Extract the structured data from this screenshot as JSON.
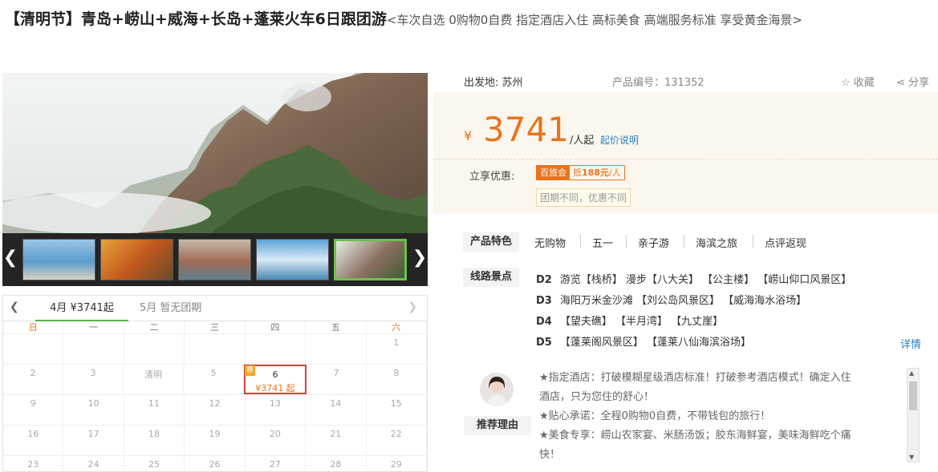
{
  "title": {
    "main": "【清明节】青岛+崂山+威海+长岛+蓬莱火车6日跟团游",
    "sub": "<车次自选 0购物0自费 指定酒店入住 高标美食 高端服务标准 享受黄金海景>"
  },
  "gallery": {
    "prev": "❮",
    "next": "❯",
    "active_index": 4
  },
  "calendar": {
    "prev": "❮",
    "next": "❯",
    "months": [
      {
        "label": "4月 ¥3741起",
        "active": true
      },
      {
        "label": "5月 暂无团期",
        "active": false
      }
    ],
    "weekdays": [
      "日",
      "一",
      "二",
      "三",
      "四",
      "五",
      "六"
    ],
    "rows": [
      [
        "",
        "",
        "",
        "",
        "",
        "",
        "1"
      ],
      [
        "2",
        "3",
        "清明",
        "5",
        "6",
        "7",
        "8"
      ],
      [
        "9",
        "10",
        "11",
        "12",
        "13",
        "14",
        "15"
      ],
      [
        "16",
        "17",
        "18",
        "19",
        "20",
        "21",
        "22"
      ],
      [
        "23",
        "24",
        "25",
        "26",
        "27",
        "28",
        "29"
      ]
    ],
    "available": {
      "day": "6",
      "price": "¥3741 起",
      "tag": "惠"
    }
  },
  "meta": {
    "departure": "出发地: 苏州",
    "product_code": "产品编号：131352",
    "favorite": "收藏",
    "share": "分享"
  },
  "price": {
    "currency": "¥",
    "amount": "3741",
    "unit": "/人起",
    "note": "起价说明"
  },
  "discount": {
    "label": "立享优惠:",
    "tag_a": "百旅会",
    "tag_b_prefix": "抵",
    "tag_b_amount": "188元",
    "tag_b_suffix": "/人",
    "note": "团期不同，优惠不同"
  },
  "features": {
    "label": "产品特色",
    "items": [
      "无购物",
      "五一",
      "亲子游",
      "海滨之旅",
      "点评返现"
    ]
  },
  "route": {
    "label": "线路景点",
    "lines": [
      {
        "day": "D2",
        "text": "游览【栈桥】 漫步【八大关】 【公主楼】 【崂山仰口风景区】"
      },
      {
        "day": "D3",
        "text": "海阳万米金沙滩 【刘公岛风景区】 【威海海水浴场】"
      },
      {
        "day": "D4",
        "text": "【望夫礁】 【半月湾】 【九丈崖】"
      },
      {
        "day": "D5",
        "text": "【蓬莱阁风景区】 【蓬莱八仙海滨浴场】"
      }
    ],
    "detail": "详情"
  },
  "recommend": {
    "label": "推荐理由",
    "lines": [
      "★指定酒店：打破模糊星级酒店标准！打破参考酒店模式！确定入住",
      "酒店，只为您住的舒心！",
      "★贴心承诺：全程0购物0自费，不带钱包的旅行！",
      "★美食专享：崂山农家宴、米肠汤饭；胶东海鲜宴，美味海鲜吃个痛",
      "快！"
    ]
  },
  "colors": {
    "accent": "#e8741c",
    "link": "#2a7fc7",
    "active_green": "#6dc04a",
    "highlight_red": "#d9413a"
  }
}
